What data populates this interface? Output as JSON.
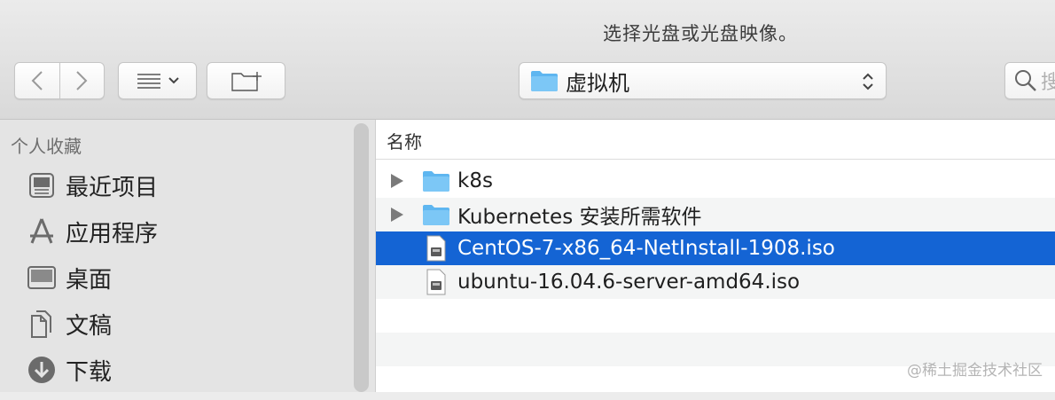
{
  "window": {
    "title": "选择光盘或光盘映像。"
  },
  "toolbar": {
    "path_label": "虚拟机",
    "search_placeholder": "搜"
  },
  "sidebar": {
    "header": "个人收藏",
    "items": [
      {
        "label": "最近项目",
        "icon": "recents-icon"
      },
      {
        "label": "应用程序",
        "icon": "applications-icon"
      },
      {
        "label": "桌面",
        "icon": "desktop-icon"
      },
      {
        "label": "文稿",
        "icon": "documents-icon"
      },
      {
        "label": "下载",
        "icon": "downloads-icon"
      }
    ]
  },
  "list": {
    "column_name": "名称",
    "rows": [
      {
        "name": "k8s",
        "type": "folder",
        "selected": false
      },
      {
        "name": "Kubernetes 安装所需软件",
        "type": "folder",
        "selected": false
      },
      {
        "name": "CentOS-7-x86_64-NetInstall-1908.iso",
        "type": "disk-image",
        "selected": true
      },
      {
        "name": "ubuntu-16.04.6-server-amd64.iso",
        "type": "disk-image",
        "selected": false
      }
    ]
  },
  "watermark": "@稀土掘金技术社区",
  "colors": {
    "selection": "#1464d4",
    "folder": "#5eb6f0"
  }
}
